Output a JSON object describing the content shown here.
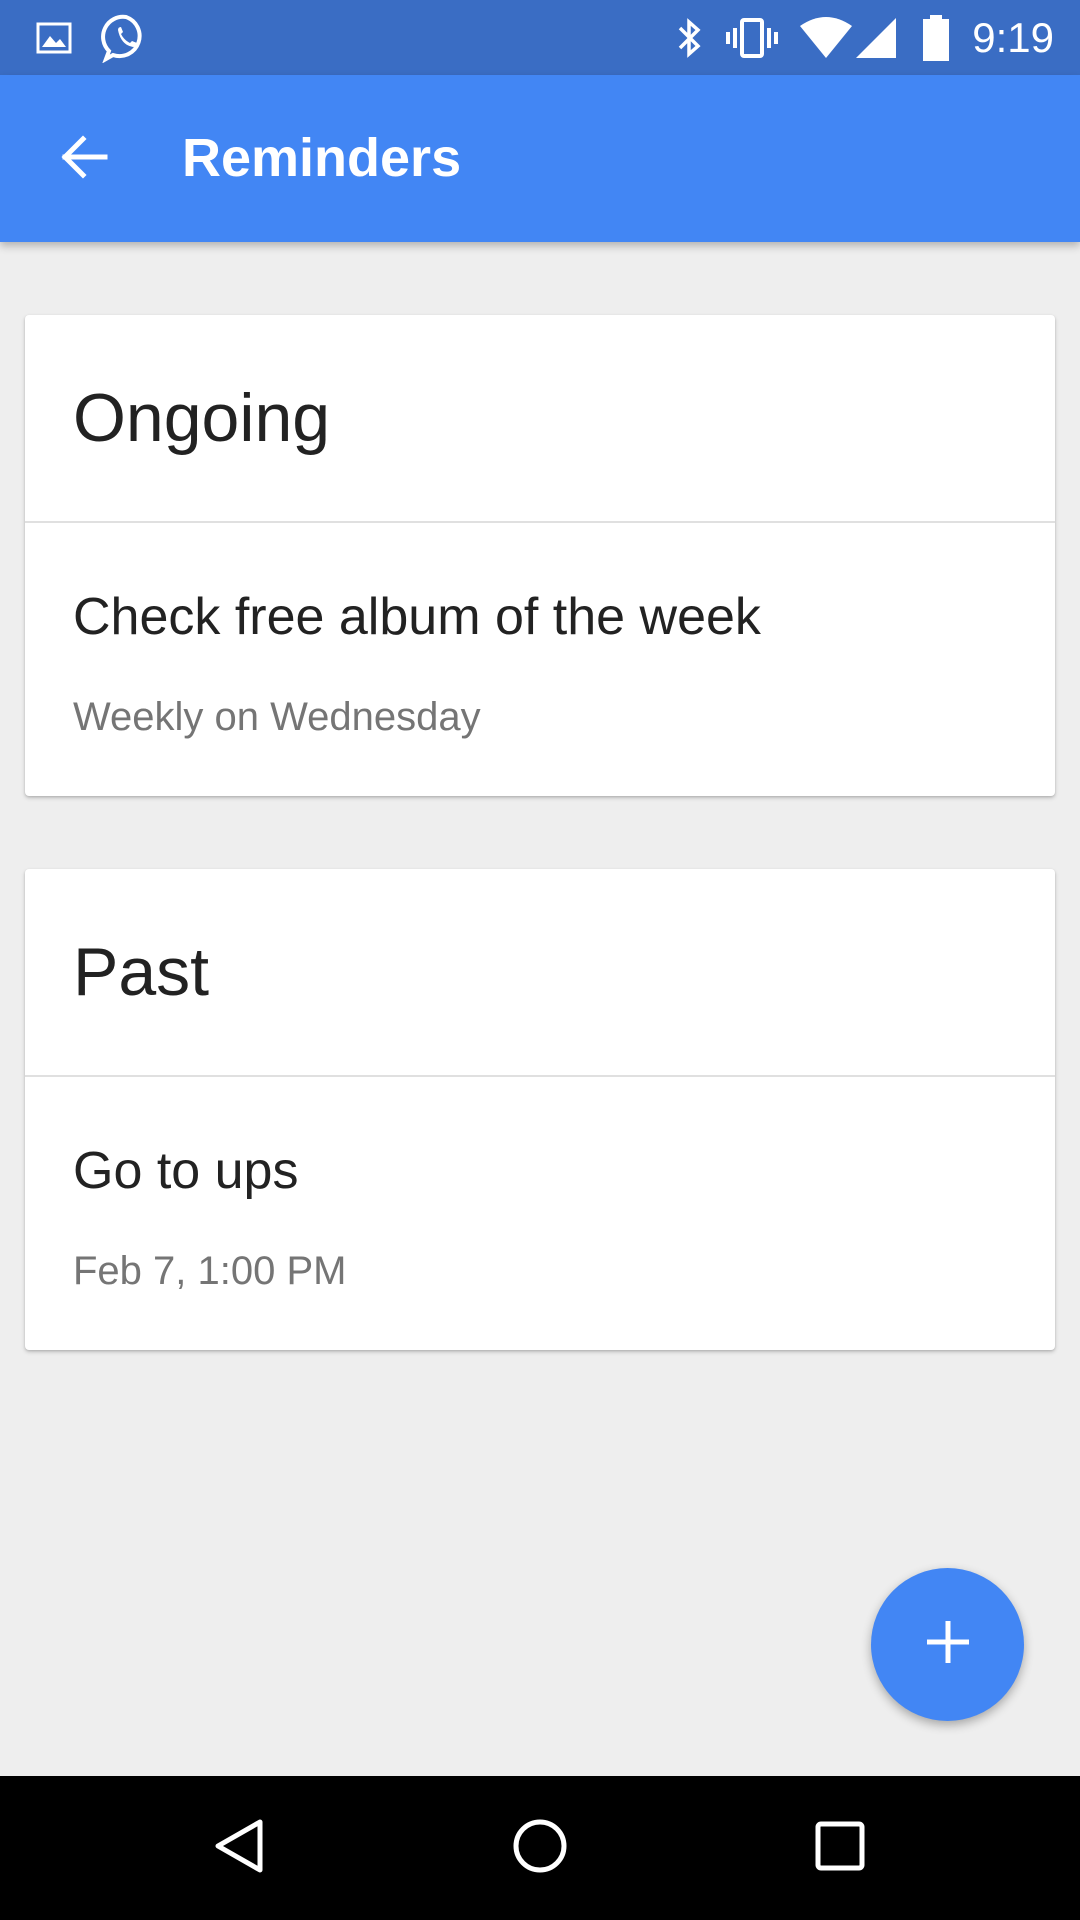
{
  "status_bar": {
    "time": "9:19",
    "left_icons": [
      "gallery-icon",
      "whatsapp-icon"
    ],
    "right_icons": [
      "bluetooth-icon",
      "vibrate-icon",
      "wifi-icon",
      "cell-signal-icon",
      "battery-icon"
    ],
    "background_color": "#3a6dc4"
  },
  "app_bar": {
    "title": "Reminders",
    "back_icon": "arrow-back-icon",
    "background_color": "#4286f4"
  },
  "sections": [
    {
      "header": "Ongoing",
      "items": [
        {
          "title": "Check free album of the week",
          "subtitle": "Weekly on Wednesday"
        }
      ]
    },
    {
      "header": "Past",
      "items": [
        {
          "title": "Go to ups",
          "subtitle": "Feb 7, 1:00 PM"
        }
      ]
    }
  ],
  "fab": {
    "icon": "plus-icon",
    "color": "#4286f4"
  },
  "nav_bar": {
    "buttons": [
      "back-triangle-icon",
      "home-circle-icon",
      "recents-square-icon"
    ]
  }
}
